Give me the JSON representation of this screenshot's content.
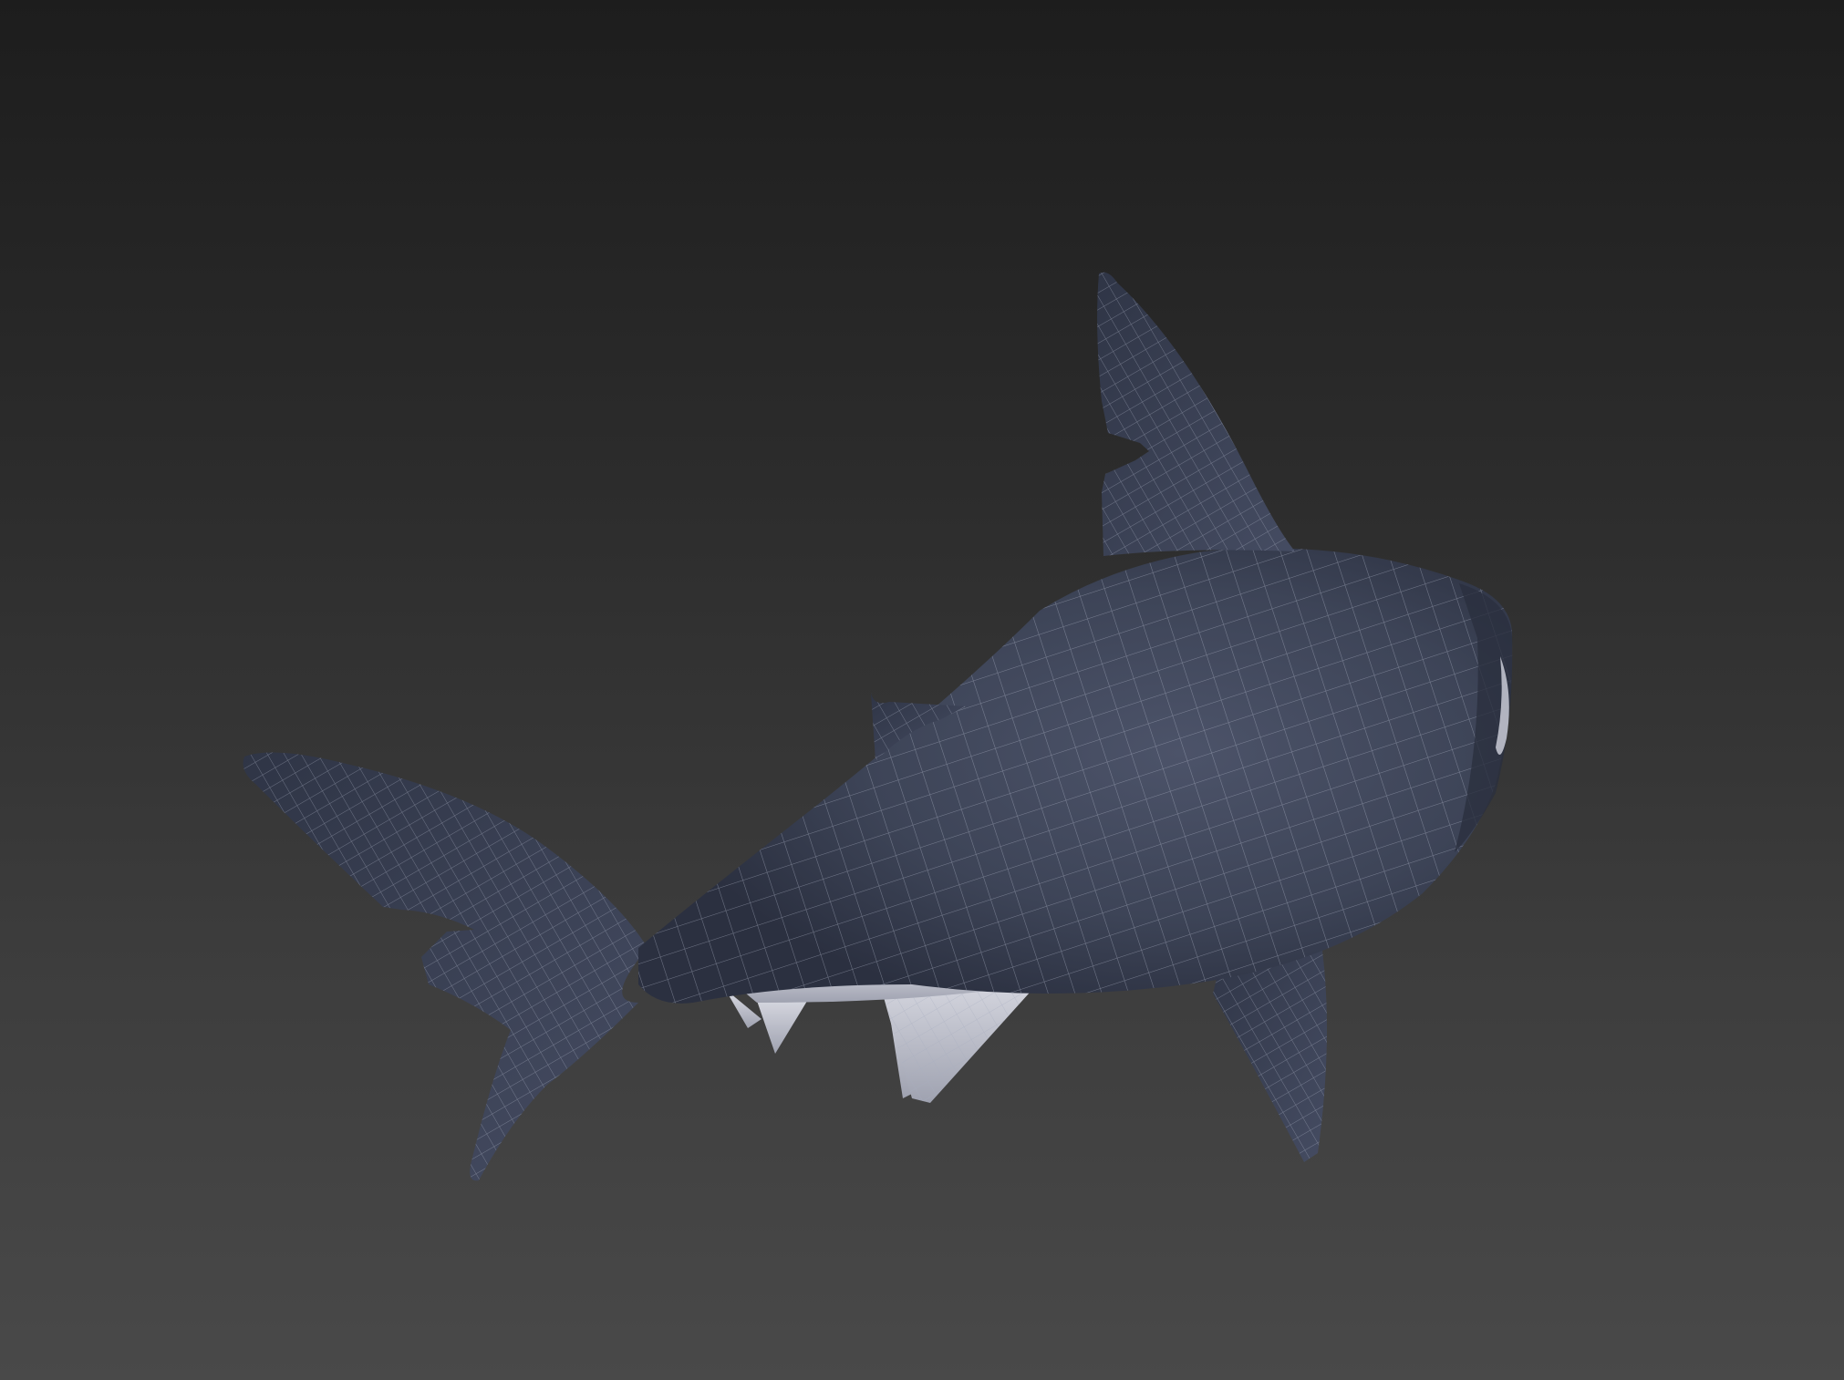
{
  "viewport": {
    "background_top": "#1d1d1d",
    "background_bottom": "#494949"
  },
  "model": {
    "subject": "shark",
    "body_color": "#3f4559",
    "body_shadow_color": "#2a2f3f",
    "belly_color": "#c9cbd6",
    "wire_color": "#a7adbf"
  }
}
